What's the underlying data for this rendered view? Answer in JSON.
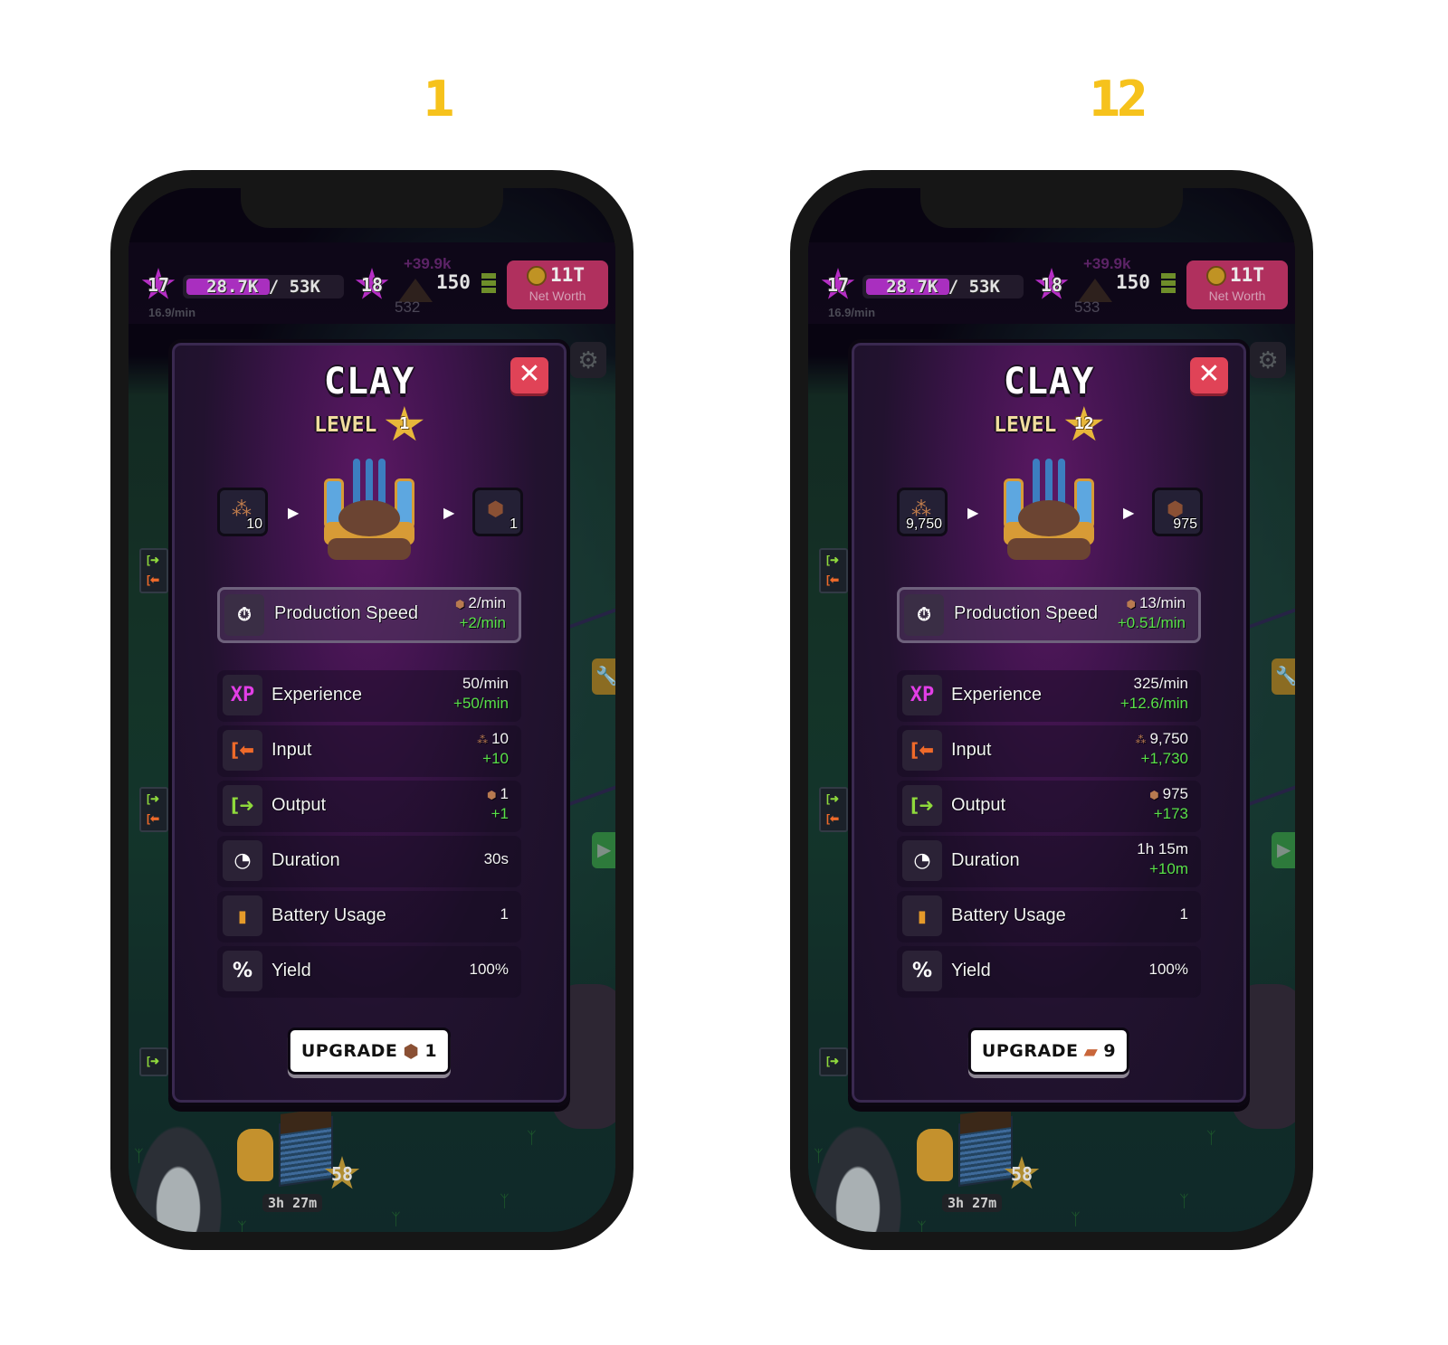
{
  "panels": [
    {
      "caption": "1",
      "hud": {
        "player_level": "17",
        "xp_text": "28.7K / 53K",
        "xp_progress": 0.54,
        "xp_rate": "16.9/min",
        "next_level": "18",
        "float_gain": "+39.9k",
        "clay_count": "532",
        "battery_count": "150",
        "net_worth_value": "11T",
        "net_worth_label": "Net Worth"
      },
      "world": {
        "building_level": "58",
        "building_timer": "3h 27m"
      },
      "modal": {
        "title": "CLAY",
        "level_label": "LEVEL",
        "level_value": "1",
        "close_icon": "close-icon",
        "recipe": {
          "input_icon": "clay-dust-icon",
          "input_count": "10",
          "output_icon": "clay-lump-icon",
          "output_count": "1"
        },
        "production_speed": {
          "label": "Production Speed",
          "icon": "stopwatch-speed-icon",
          "value": "2/min",
          "delta": "+2/min"
        },
        "stats": [
          {
            "key": "experience",
            "label": "Experience",
            "icon": "xp-icon",
            "value": "50/min",
            "delta": "+50/min",
            "value_icon": ""
          },
          {
            "key": "input",
            "label": "Input",
            "icon": "input-arrow-icon",
            "value": "10",
            "delta": "+10",
            "value_icon": "clay-dust-icon"
          },
          {
            "key": "output",
            "label": "Output",
            "icon": "output-arrow-icon",
            "value": "1",
            "delta": "+1",
            "value_icon": "clay-lump-icon"
          },
          {
            "key": "duration",
            "label": "Duration",
            "icon": "clock-icon",
            "value": "30s",
            "delta": "",
            "value_icon": ""
          },
          {
            "key": "battery",
            "label": "Battery Usage",
            "icon": "battery-icon",
            "value": "1",
            "delta": "",
            "value_icon": ""
          },
          {
            "key": "yield",
            "label": "Yield",
            "icon": "percent-icon",
            "value": "100%",
            "delta": "",
            "value_icon": ""
          }
        ],
        "upgrade": {
          "label": "UPGRADE",
          "cost_icon": "clay-lump-icon",
          "cost": "1"
        }
      }
    },
    {
      "caption": "12",
      "hud": {
        "player_level": "17",
        "xp_text": "28.7K / 53K",
        "xp_progress": 0.54,
        "xp_rate": "16.9/min",
        "next_level": "18",
        "float_gain": "+39.9k",
        "clay_count": "533",
        "battery_count": "150",
        "net_worth_value": "11T",
        "net_worth_label": "Net Worth"
      },
      "world": {
        "building_level": "58",
        "building_timer": "3h 27m"
      },
      "modal": {
        "title": "CLAY",
        "level_label": "LEVEL",
        "level_value": "12",
        "close_icon": "close-icon",
        "recipe": {
          "input_icon": "clay-dust-icon",
          "input_count": "9,750",
          "output_icon": "clay-lump-icon",
          "output_count": "975"
        },
        "production_speed": {
          "label": "Production Speed",
          "icon": "stopwatch-speed-icon",
          "value": "13/min",
          "delta": "+0.51/min"
        },
        "stats": [
          {
            "key": "experience",
            "label": "Experience",
            "icon": "xp-icon",
            "value": "325/min",
            "delta": "+12.6/min",
            "value_icon": ""
          },
          {
            "key": "input",
            "label": "Input",
            "icon": "input-arrow-icon",
            "value": "9,750",
            "delta": "+1,730",
            "value_icon": "clay-dust-icon"
          },
          {
            "key": "output",
            "label": "Output",
            "icon": "output-arrow-icon",
            "value": "975",
            "delta": "+173",
            "value_icon": "clay-lump-icon"
          },
          {
            "key": "duration",
            "label": "Duration",
            "icon": "clock-icon",
            "value": "1h 15m",
            "delta": "+10m",
            "value_icon": ""
          },
          {
            "key": "battery",
            "label": "Battery Usage",
            "icon": "battery-icon",
            "value": "1",
            "delta": "",
            "value_icon": ""
          },
          {
            "key": "yield",
            "label": "Yield",
            "icon": "percent-icon",
            "value": "100%",
            "delta": "",
            "value_icon": ""
          }
        ],
        "upgrade": {
          "label": "UPGRADE",
          "cost_icon": "brick-icon",
          "cost": "9"
        }
      }
    }
  ],
  "colors": {
    "caption": "#f6c21c",
    "close_button": "#e04357",
    "net_worth_badge": "#b0305e",
    "xp_fill": "#a92fbf",
    "delta_green": "#59e049",
    "modal_bg": "#3e144c"
  }
}
